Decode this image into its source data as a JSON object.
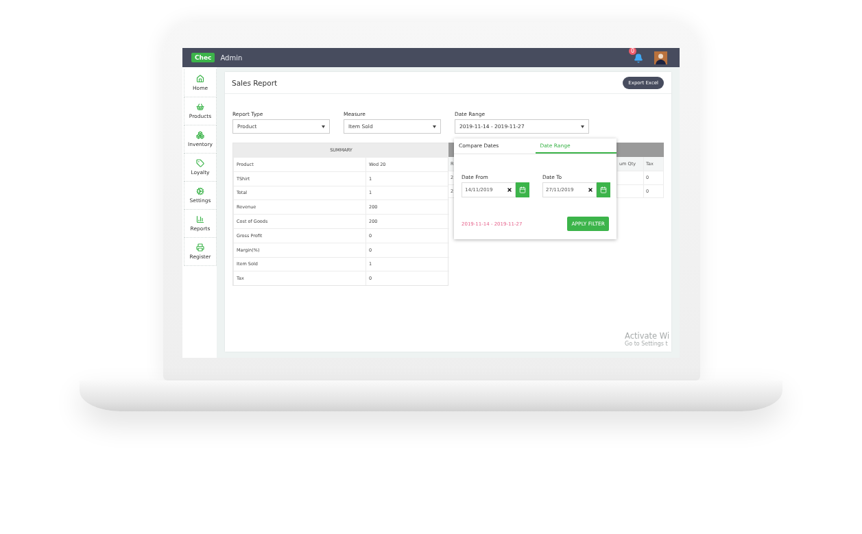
{
  "topbar": {
    "logo": "Chec",
    "title": "Admin",
    "notification_count": "0"
  },
  "sidebar": {
    "items": [
      {
        "label": "Home"
      },
      {
        "label": "Products"
      },
      {
        "label": "Inventory"
      },
      {
        "label": "Loyalty"
      },
      {
        "label": "Settings"
      },
      {
        "label": "Reports"
      },
      {
        "label": "Register"
      }
    ]
  },
  "page": {
    "title": "Sales Report",
    "export_button": "Export Excel"
  },
  "filters": [
    {
      "label": "Report Type",
      "value": "Product"
    },
    {
      "label": "Measure",
      "value": "Item Sold"
    },
    {
      "label": "Date Range",
      "value": "2019-11-14 - 2019-11-27"
    }
  ],
  "summary_table": {
    "title": "SUMMARY",
    "columns": [
      "Product",
      "Wed 20"
    ],
    "rows": [
      [
        "TShirt",
        "1"
      ],
      [
        "Total",
        "1"
      ],
      [
        "Revenue",
        "200"
      ],
      [
        "Cost of Goods",
        "200"
      ],
      [
        "Gross Profit",
        "0"
      ],
      [
        "Margin(%)",
        "0"
      ],
      [
        "Item Sold",
        "1"
      ],
      [
        "Tax",
        "0"
      ]
    ]
  },
  "detail_table": {
    "column_1": "R",
    "column_3": "um Qty",
    "column_4": "Tax",
    "rows": [
      {
        "column_1": "2",
        "column_4": "0"
      },
      {
        "column_1": "2",
        "column_4": "0"
      }
    ]
  },
  "date_popup": {
    "tabs": [
      {
        "label": "Compare Dates",
        "selected": false
      },
      {
        "label": "Date Range",
        "selected": true
      }
    ],
    "fields": [
      {
        "label": "Date From",
        "value": "14/11/2019"
      },
      {
        "label": "Date To",
        "value": "27/11/2019"
      }
    ],
    "range_text": "2019-11-14 - 2019-11-27",
    "apply_button": "APPLY FILTER"
  },
  "activation_notice": {
    "title": "Activate Wi",
    "subtitle": "Go to Settings t"
  }
}
